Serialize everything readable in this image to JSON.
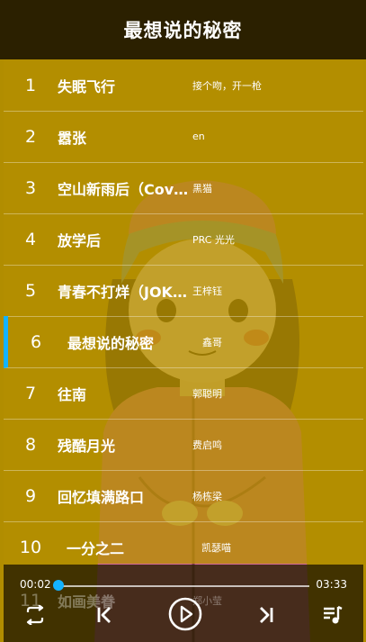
{
  "header": {
    "title": "最想说的秘密"
  },
  "songs": [
    {
      "num": "1",
      "name": "失眠飞行",
      "artist": "接个吻，开一枪"
    },
    {
      "num": "2",
      "name": "嚣张",
      "artist": "en"
    },
    {
      "num": "3",
      "name": "空山新雨后（Cover：…",
      "artist": "黑猫"
    },
    {
      "num": "4",
      "name": "放学后",
      "artist": "PRC 光光"
    },
    {
      "num": "5",
      "name": "青春不打烊（JOKER…",
      "artist": "王梓钰"
    },
    {
      "num": "6",
      "name": "最想说的秘密",
      "artist": "鑫哥",
      "active": true
    },
    {
      "num": "7",
      "name": "往南",
      "artist": "郭聪明"
    },
    {
      "num": "8",
      "name": "残酷月光",
      "artist": "费启鸣"
    },
    {
      "num": "9",
      "name": "回忆填满路口",
      "artist": "杨栋梁"
    },
    {
      "num": "10",
      "name": "一分之二",
      "artist": "凯瑟喵"
    },
    {
      "num": "11",
      "name": "如画美眷",
      "artist": "郑小莹"
    }
  ],
  "player": {
    "current_time": "00:02",
    "total_time": "03:33",
    "progress": 0.01,
    "icons": [
      "repeat-icon",
      "previous-icon",
      "play-icon",
      "next-icon",
      "playlist-icon"
    ]
  },
  "colors": {
    "accent": "#13b3ff",
    "header_bg": "#2b2000",
    "list_bg": "#b18d00"
  }
}
